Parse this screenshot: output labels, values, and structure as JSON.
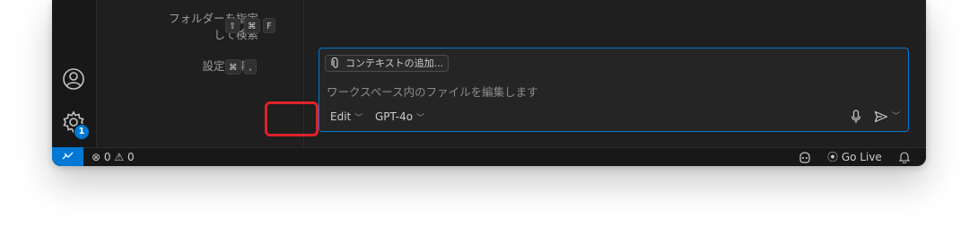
{
  "shortcuts": [
    {
      "label_line1": "フォルダーを指定",
      "label_line2": "して検索",
      "keys": [
        "⇧",
        "⌘",
        "F"
      ]
    },
    {
      "label": "設定を開く",
      "keys": [
        "⌘",
        ","
      ]
    }
  ],
  "activity_bar": {
    "account_icon": "account-icon",
    "settings_icon": "gear-icon",
    "settings_badge": "1"
  },
  "chat": {
    "add_context_label": "コンテキストの追加...",
    "input_placeholder": "ワークスペース内のファイルを編集します",
    "mode_label": "Edit",
    "model_label": "GPT-4o",
    "accent_color": "#0078d4"
  },
  "status_bar": {
    "error_count": "0",
    "warning_count": "0",
    "go_live_label": "Go Live"
  },
  "highlight_color": "#e0222a"
}
